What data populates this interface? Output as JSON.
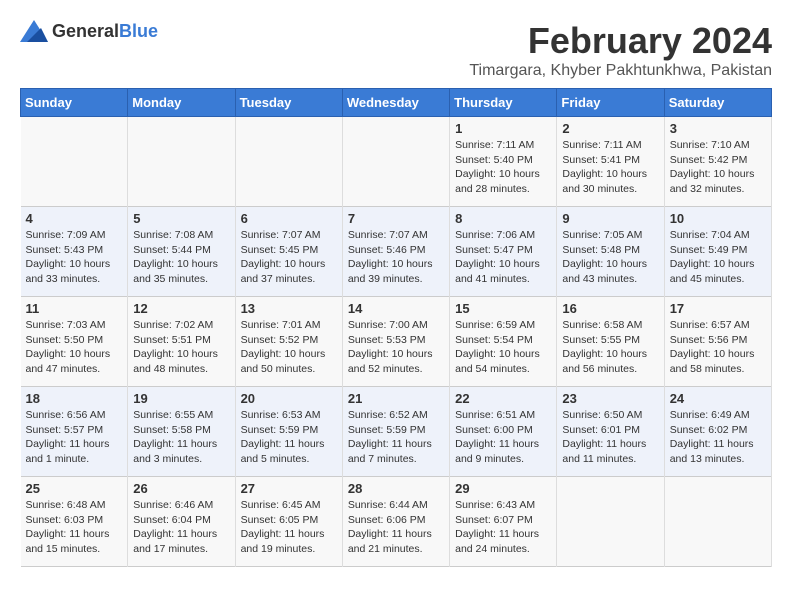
{
  "logo": {
    "text_general": "General",
    "text_blue": "Blue"
  },
  "title": "February 2024",
  "subtitle": "Timargara, Khyber Pakhtunkhwa, Pakistan",
  "headers": [
    "Sunday",
    "Monday",
    "Tuesday",
    "Wednesday",
    "Thursday",
    "Friday",
    "Saturday"
  ],
  "weeks": [
    [
      {
        "day": "",
        "info": ""
      },
      {
        "day": "",
        "info": ""
      },
      {
        "day": "",
        "info": ""
      },
      {
        "day": "",
        "info": ""
      },
      {
        "day": "1",
        "info": "Sunrise: 7:11 AM\nSunset: 5:40 PM\nDaylight: 10 hours and 28 minutes."
      },
      {
        "day": "2",
        "info": "Sunrise: 7:11 AM\nSunset: 5:41 PM\nDaylight: 10 hours and 30 minutes."
      },
      {
        "day": "3",
        "info": "Sunrise: 7:10 AM\nSunset: 5:42 PM\nDaylight: 10 hours and 32 minutes."
      }
    ],
    [
      {
        "day": "4",
        "info": "Sunrise: 7:09 AM\nSunset: 5:43 PM\nDaylight: 10 hours and 33 minutes."
      },
      {
        "day": "5",
        "info": "Sunrise: 7:08 AM\nSunset: 5:44 PM\nDaylight: 10 hours and 35 minutes."
      },
      {
        "day": "6",
        "info": "Sunrise: 7:07 AM\nSunset: 5:45 PM\nDaylight: 10 hours and 37 minutes."
      },
      {
        "day": "7",
        "info": "Sunrise: 7:07 AM\nSunset: 5:46 PM\nDaylight: 10 hours and 39 minutes."
      },
      {
        "day": "8",
        "info": "Sunrise: 7:06 AM\nSunset: 5:47 PM\nDaylight: 10 hours and 41 minutes."
      },
      {
        "day": "9",
        "info": "Sunrise: 7:05 AM\nSunset: 5:48 PM\nDaylight: 10 hours and 43 minutes."
      },
      {
        "day": "10",
        "info": "Sunrise: 7:04 AM\nSunset: 5:49 PM\nDaylight: 10 hours and 45 minutes."
      }
    ],
    [
      {
        "day": "11",
        "info": "Sunrise: 7:03 AM\nSunset: 5:50 PM\nDaylight: 10 hours and 47 minutes."
      },
      {
        "day": "12",
        "info": "Sunrise: 7:02 AM\nSunset: 5:51 PM\nDaylight: 10 hours and 48 minutes."
      },
      {
        "day": "13",
        "info": "Sunrise: 7:01 AM\nSunset: 5:52 PM\nDaylight: 10 hours and 50 minutes."
      },
      {
        "day": "14",
        "info": "Sunrise: 7:00 AM\nSunset: 5:53 PM\nDaylight: 10 hours and 52 minutes."
      },
      {
        "day": "15",
        "info": "Sunrise: 6:59 AM\nSunset: 5:54 PM\nDaylight: 10 hours and 54 minutes."
      },
      {
        "day": "16",
        "info": "Sunrise: 6:58 AM\nSunset: 5:55 PM\nDaylight: 10 hours and 56 minutes."
      },
      {
        "day": "17",
        "info": "Sunrise: 6:57 AM\nSunset: 5:56 PM\nDaylight: 10 hours and 58 minutes."
      }
    ],
    [
      {
        "day": "18",
        "info": "Sunrise: 6:56 AM\nSunset: 5:57 PM\nDaylight: 11 hours and 1 minute."
      },
      {
        "day": "19",
        "info": "Sunrise: 6:55 AM\nSunset: 5:58 PM\nDaylight: 11 hours and 3 minutes."
      },
      {
        "day": "20",
        "info": "Sunrise: 6:53 AM\nSunset: 5:59 PM\nDaylight: 11 hours and 5 minutes."
      },
      {
        "day": "21",
        "info": "Sunrise: 6:52 AM\nSunset: 5:59 PM\nDaylight: 11 hours and 7 minutes."
      },
      {
        "day": "22",
        "info": "Sunrise: 6:51 AM\nSunset: 6:00 PM\nDaylight: 11 hours and 9 minutes."
      },
      {
        "day": "23",
        "info": "Sunrise: 6:50 AM\nSunset: 6:01 PM\nDaylight: 11 hours and 11 minutes."
      },
      {
        "day": "24",
        "info": "Sunrise: 6:49 AM\nSunset: 6:02 PM\nDaylight: 11 hours and 13 minutes."
      }
    ],
    [
      {
        "day": "25",
        "info": "Sunrise: 6:48 AM\nSunset: 6:03 PM\nDaylight: 11 hours and 15 minutes."
      },
      {
        "day": "26",
        "info": "Sunrise: 6:46 AM\nSunset: 6:04 PM\nDaylight: 11 hours and 17 minutes."
      },
      {
        "day": "27",
        "info": "Sunrise: 6:45 AM\nSunset: 6:05 PM\nDaylight: 11 hours and 19 minutes."
      },
      {
        "day": "28",
        "info": "Sunrise: 6:44 AM\nSunset: 6:06 PM\nDaylight: 11 hours and 21 minutes."
      },
      {
        "day": "29",
        "info": "Sunrise: 6:43 AM\nSunset: 6:07 PM\nDaylight: 11 hours and 24 minutes."
      },
      {
        "day": "",
        "info": ""
      },
      {
        "day": "",
        "info": ""
      }
    ]
  ]
}
